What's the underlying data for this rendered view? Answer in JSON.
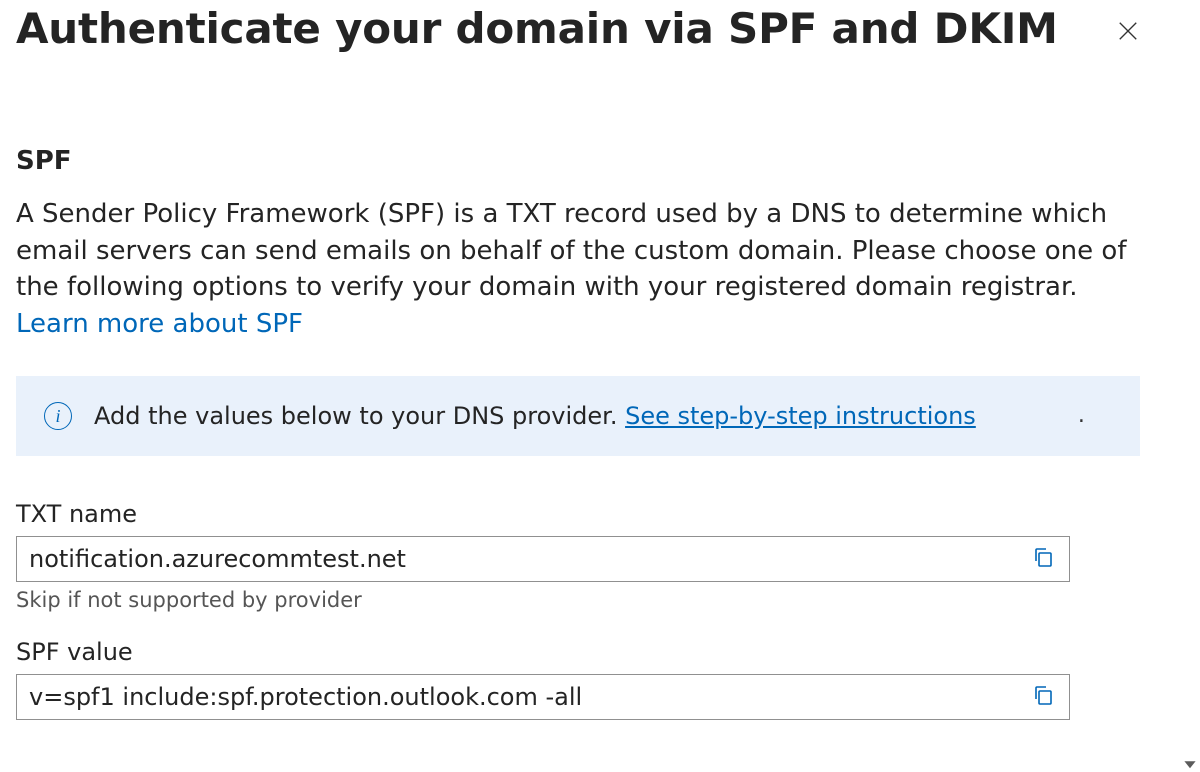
{
  "header": {
    "title": "Authenticate your domain via SPF and DKIM"
  },
  "spf": {
    "heading": "SPF",
    "description_before_link": "A Sender Policy Framework (SPF) is a TXT record used by a DNS to determine which email servers can send emails on behalf of the custom domain. Please choose one of the following options to verify your domain with your registered domain registrar. ",
    "learn_more_label": "Learn more about SPF",
    "infobar_text": "Add the values below to your DNS provider.  ",
    "infobar_link": "See step-by-step instructions",
    "txt_name_label": "TXT name",
    "txt_name_value": "notification.azurecommtest.net",
    "txt_name_helper": "Skip if not supported by provider",
    "spf_value_label": "SPF value",
    "spf_value_value": "v=spf1 include:spf.protection.outlook.com -all"
  }
}
